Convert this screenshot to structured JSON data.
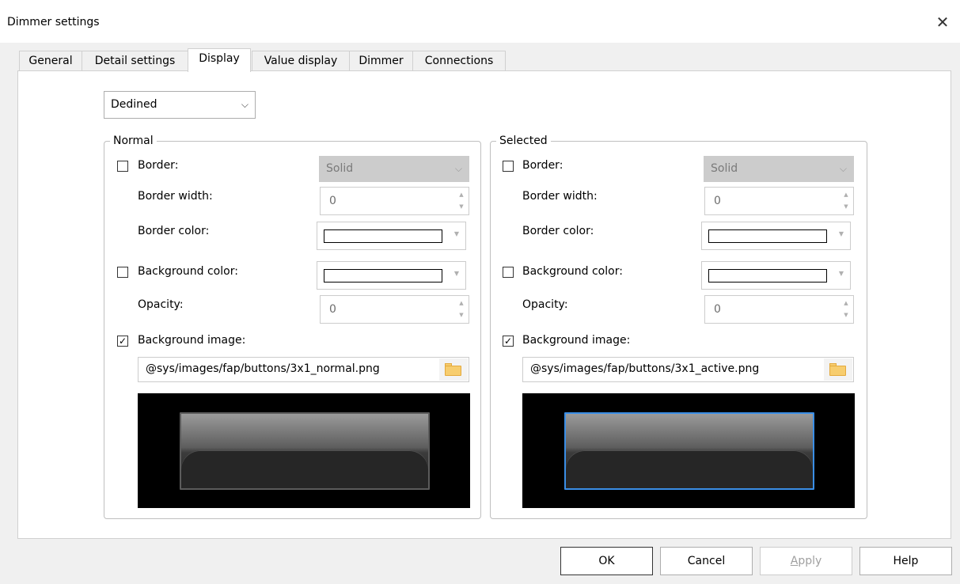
{
  "window": {
    "title": "Dimmer settings",
    "close_glyph": "✕"
  },
  "tabs": [
    {
      "label": "General"
    },
    {
      "label": "Detail settings"
    },
    {
      "label": "Display",
      "active": true
    },
    {
      "label": "Value display"
    },
    {
      "label": "Dimmer"
    },
    {
      "label": "Connections"
    }
  ],
  "mode_select": {
    "value": "Dedined"
  },
  "normal": {
    "legend": "Normal",
    "border": {
      "label": "Border:",
      "checked": false,
      "style": "Solid"
    },
    "border_width": {
      "label": "Border width:",
      "value": "0"
    },
    "border_color": {
      "label": "Border color:",
      "color": "#ffffff"
    },
    "background_color": {
      "label": "Background color:",
      "checked": false,
      "color": "#ffffff"
    },
    "opacity": {
      "label": "Opacity:",
      "value": "0"
    },
    "background_image": {
      "label": "Background image:",
      "checked": true,
      "path": "@sys/images/fap/buttons/3x1_normal.png"
    }
  },
  "selected": {
    "legend": "Selected",
    "border": {
      "label": "Border:",
      "checked": false,
      "style": "Solid"
    },
    "border_width": {
      "label": "Border width:",
      "value": "0"
    },
    "border_color": {
      "label": "Border color:",
      "color": "#ffffff"
    },
    "background_color": {
      "label": "Background color:",
      "checked": false,
      "color": "#ffffff"
    },
    "opacity": {
      "label": "Opacity:",
      "value": "0"
    },
    "background_image": {
      "label": "Background image:",
      "checked": true,
      "path": "@sys/images/fap/buttons/3x1_active.png"
    }
  },
  "buttons": {
    "ok": "OK",
    "cancel": "Cancel",
    "apply_prefix": "",
    "apply_mnemonic": "A",
    "apply_rest": "pply",
    "help": "Help"
  },
  "icons": {
    "check": "✓",
    "chevron_down": "⌵",
    "spin_up": "▲",
    "spin_down": "▼",
    "dropdown": "▼",
    "folder": "folder-icon"
  },
  "colors": {
    "selected_frame": "#3a8ee6",
    "disabled_fill": "#cccccc"
  }
}
